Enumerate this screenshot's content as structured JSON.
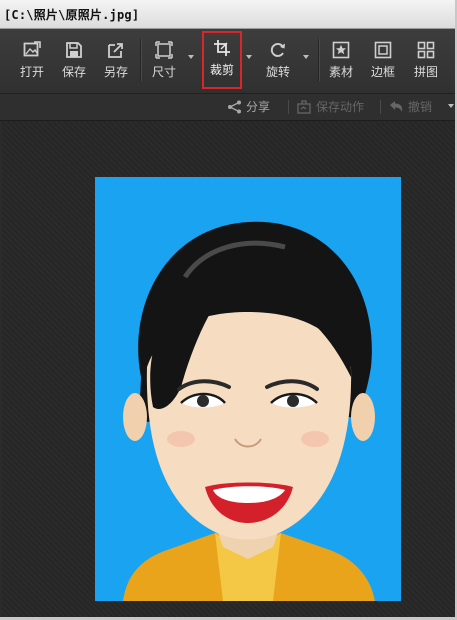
{
  "window": {
    "title": "[C:\\照片\\原照片.jpg]"
  },
  "toolbar": {
    "items": [
      {
        "label": "打开",
        "icon": "open-image-icon"
      },
      {
        "label": "保存",
        "icon": "save-icon"
      },
      {
        "label": "另存",
        "icon": "save-as-icon"
      },
      {
        "label": "尺寸",
        "icon": "resize-icon"
      },
      {
        "label": "裁剪",
        "icon": "crop-icon",
        "active": true
      },
      {
        "label": "旋转",
        "icon": "rotate-icon"
      },
      {
        "label": "素材",
        "icon": "material-icon"
      },
      {
        "label": "边框",
        "icon": "frame-icon"
      },
      {
        "label": "拼图",
        "icon": "collage-icon"
      }
    ]
  },
  "subtoolbar": {
    "share": "分享",
    "save_action": "保存动作",
    "undo": "撤销"
  },
  "colors": {
    "photo_background": "#1aa3f0",
    "active_outline": "#d8262a"
  }
}
